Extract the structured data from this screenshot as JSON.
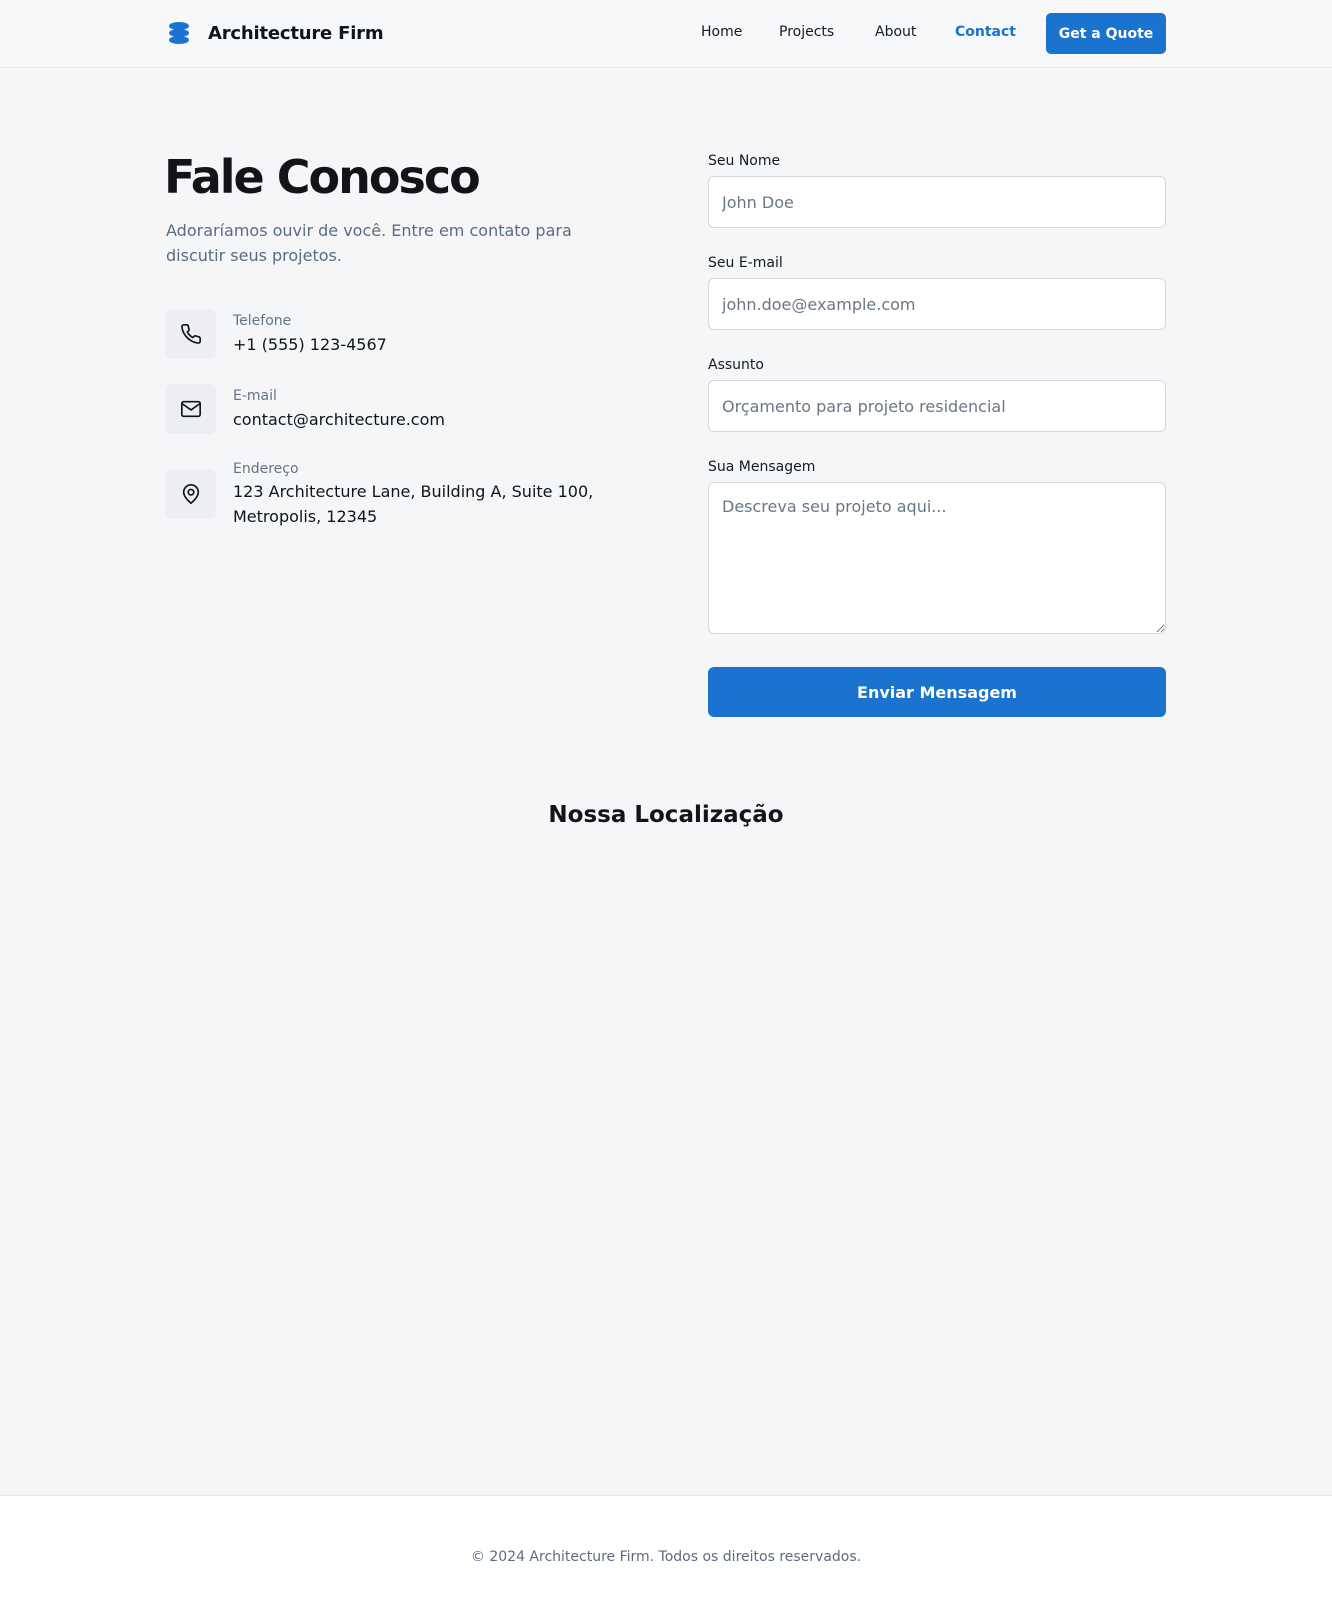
{
  "header": {
    "brand": "Architecture Firm",
    "nav": [
      {
        "label": "Home"
      },
      {
        "label": "Projects"
      },
      {
        "label": "About"
      },
      {
        "label": "Contact",
        "active": true
      }
    ],
    "cta": "Get a Quote"
  },
  "contact": {
    "title": "Fale Conosco",
    "intro": "Adoraríamos ouvir de você. Entre em contato para discutir seus projetos.",
    "items": [
      {
        "icon": "phone-icon",
        "label": "Telefone",
        "value": "+1 (555) 123-4567"
      },
      {
        "icon": "mail-icon",
        "label": "E-mail",
        "value": "contact@architecture.com"
      },
      {
        "icon": "location-pin-icon",
        "label": "Endereço",
        "value_line1": "123 Architecture Lane, Building A, Suite 100,",
        "value_line2": "Metropolis, 12345"
      }
    ]
  },
  "form": {
    "name_label": "Seu Nome",
    "name_placeholder": "John Doe",
    "email_label": "Seu E-mail",
    "email_placeholder": "john.doe@example.com",
    "subject_label": "Assunto",
    "subject_placeholder": "Orçamento para projeto residencial",
    "message_label": "Sua Mensagem",
    "message_placeholder": "Descreva seu projeto aqui...",
    "submit": "Enviar Mensagem"
  },
  "location": {
    "title": "Nossa Localização"
  },
  "footer": {
    "text": "© 2024 Architecture Firm. Todos os direitos reservados."
  },
  "colors": {
    "accent": "#1a73cf",
    "background": "#f5f6f8",
    "muted_text": "#5b6b82"
  }
}
